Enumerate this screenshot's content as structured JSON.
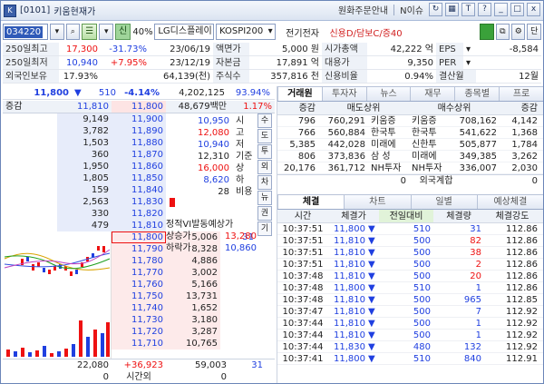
{
  "window": {
    "code_tag": "[0101]",
    "title": "키움현재가",
    "links": [
      "원화주문안내",
      "N이슈"
    ],
    "buttons": [
      "T",
      "?",
      "_",
      "□",
      "x"
    ]
  },
  "toolbar": {
    "code": "034220",
    "percent": "40%",
    "sin_label": "신",
    "name": "LG디스플레이",
    "market": "KOSPI200",
    "sector": "전기전자",
    "credit": "신용D/담보C/증40",
    "end_button": "단"
  },
  "info": {
    "high250_label": "250일최고",
    "high250_value": "17,300",
    "high250_pct": "-31.73%",
    "high250_date": "23/06/19",
    "low250_label": "250일최저",
    "low250_value": "10,940",
    "low250_pct": "+7.95%",
    "low250_date": "23/12/19",
    "foreign_label": "외국인보유",
    "foreign_value": "17.93%",
    "par_label": "액면가",
    "par_value": "5,000 원",
    "capital_label": "자본금",
    "capital_value": "17,891 억",
    "shares_label": "주식수",
    "shares_value": "357,816 천",
    "shares_sub": "64,139(천)",
    "mcap_label": "시가총액",
    "mcap_value": "42,222 억",
    "substitute_label": "대용가",
    "substitute_value": "9,350",
    "credit_label": "신용비율",
    "credit_value": "0.94%",
    "eps_label": "EPS",
    "eps_value": "-8,584",
    "per_label": "PER",
    "per_value": "",
    "settle_label": "결산월",
    "settle_value": "12월"
  },
  "price_bar": {
    "price": "11,800",
    "arrow": "▼",
    "change": "510",
    "change_pct": "-4.14%",
    "volume": "4,202,125",
    "vol_pct": "93.94%"
  },
  "ob_head": {
    "col1": "증감",
    "col2": "11,810",
    "col3": "11,800",
    "col4": "48,679백만",
    "col5": "1.17%"
  },
  "asks": [
    {
      "qty": "9,149",
      "price": "11,900"
    },
    {
      "qty": "3,782",
      "price": "11,890"
    },
    {
      "qty": "1,503",
      "price": "11,880"
    },
    {
      "qty": "360",
      "price": "11,870"
    },
    {
      "qty": "1,950",
      "price": "11,860"
    },
    {
      "qty": "1,805",
      "price": "11,850"
    },
    {
      "qty": "159",
      "price": "11,840"
    },
    {
      "qty": "2,563",
      "price": "11,830"
    },
    {
      "qty": "330",
      "price": "11,820"
    },
    {
      "qty": "479",
      "price": "11,810"
    }
  ],
  "bids": [
    {
      "price": "11,800",
      "qty": "5,006",
      "chg": "31"
    },
    {
      "price": "11,790",
      "qty": "8,328",
      "chg": ""
    },
    {
      "price": "11,780",
      "qty": "4,886",
      "chg": ""
    },
    {
      "price": "11,770",
      "qty": "3,002",
      "chg": ""
    },
    {
      "price": "11,760",
      "qty": "5,166",
      "chg": ""
    },
    {
      "price": "11,750",
      "qty": "13,731",
      "chg": ""
    },
    {
      "price": "11,740",
      "qty": "1,652",
      "chg": ""
    },
    {
      "price": "11,730",
      "qty": "3,180",
      "chg": ""
    },
    {
      "price": "11,720",
      "qty": "3,287",
      "chg": ""
    },
    {
      "price": "11,710",
      "qty": "10,765",
      "chg": ""
    }
  ],
  "ohlc": [
    {
      "value": "10,950",
      "label": "시"
    },
    {
      "value": "12,080",
      "label": "고"
    },
    {
      "value": "10,940",
      "label": "저"
    },
    {
      "value": "12,310",
      "label": "기준"
    },
    {
      "value": "16,000",
      "label": "상"
    },
    {
      "value": "8,620",
      "label": "하"
    },
    {
      "value": "28",
      "label": "비용"
    }
  ],
  "vi": {
    "title": "정적VI발동예상가",
    "up_label": "상승가",
    "up_value": "13,280",
    "down_label": "하락가",
    "down_value": "10,860"
  },
  "side_tabs": [
    "수",
    "도",
    "투",
    "외",
    "차",
    "뉴",
    "권",
    "기"
  ],
  "summary": {
    "ask_total": "22,080",
    "diff": "+36,923",
    "bid_total": "59,003",
    "chg": "31",
    "after_label": "시간외",
    "after_value": "0"
  },
  "right_tabs": [
    "거래원",
    "투자자",
    "뉴스",
    "재무",
    "종목별",
    "프로"
  ],
  "broker_head": {
    "chg1": "증감",
    "sell": "매도상위",
    "buy": "매수상위",
    "chg2": "증감"
  },
  "brokers": [
    {
      "chg1": "796",
      "sell_qty": "760,291",
      "sell_name": "키움증",
      "buy_name": "키움증",
      "buy_qty": "708,162",
      "chg2": "4,142"
    },
    {
      "chg1": "766",
      "sell_qty": "560,884",
      "sell_name": "한국투",
      "buy_name": "한국투",
      "buy_qty": "541,622",
      "chg2": "1,368"
    },
    {
      "chg1": "5,385",
      "sell_qty": "442,028",
      "sell_name": "미래에",
      "buy_name": "신한투",
      "buy_qty": "505,877",
      "chg2": "1,784"
    },
    {
      "chg1": "806",
      "sell_qty": "373,836",
      "sell_name": "삼 성",
      "buy_name": "미래에",
      "buy_qty": "349,385",
      "chg2": "3,262"
    },
    {
      "chg1": "20,176",
      "sell_qty": "361,712",
      "sell_name": "NH투자",
      "buy_name": "NH투자",
      "buy_qty": "336,007",
      "chg2": "2,030"
    }
  ],
  "foreign_row": {
    "left": "0",
    "label": "외국계합",
    "right": "0"
  },
  "trade_tabs": [
    "체결",
    "차트",
    "일별",
    "예상체결"
  ],
  "trade_head": {
    "time": "시간",
    "price": "체결가",
    "change": "전일대비",
    "qty": "체결량",
    "strength": "체결강도"
  },
  "trades": [
    {
      "time": "10:37:51",
      "price": "11,800",
      "dir": "▼",
      "change": "510",
      "qty": "31",
      "side": "buy",
      "strength": "112.86"
    },
    {
      "time": "10:37:51",
      "price": "11,810",
      "dir": "▼",
      "change": "500",
      "qty": "82",
      "side": "sell",
      "strength": "112.86"
    },
    {
      "time": "10:37:51",
      "price": "11,810",
      "dir": "▼",
      "change": "500",
      "qty": "38",
      "side": "sell",
      "strength": "112.86"
    },
    {
      "time": "10:37:51",
      "price": "11,810",
      "dir": "▼",
      "change": "500",
      "qty": "2",
      "side": "sell",
      "strength": "112.86"
    },
    {
      "time": "10:37:48",
      "price": "11,810",
      "dir": "▼",
      "change": "500",
      "qty": "20",
      "side": "sell",
      "strength": "112.86"
    },
    {
      "time": "10:37:48",
      "price": "11,800",
      "dir": "▼",
      "change": "510",
      "qty": "1",
      "side": "buy",
      "strength": "112.86"
    },
    {
      "time": "10:37:48",
      "price": "11,810",
      "dir": "▼",
      "change": "500",
      "qty": "965",
      "side": "buy",
      "strength": "112.85"
    },
    {
      "time": "10:37:47",
      "price": "11,810",
      "dir": "▼",
      "change": "500",
      "qty": "7",
      "side": "buy",
      "strength": "112.92"
    },
    {
      "time": "10:37:44",
      "price": "11,810",
      "dir": "▼",
      "change": "500",
      "qty": "1",
      "side": "buy",
      "strength": "112.92"
    },
    {
      "time": "10:37:44",
      "price": "11,810",
      "dir": "▼",
      "change": "500",
      "qty": "1",
      "side": "buy",
      "strength": "112.92"
    },
    {
      "time": "10:37:44",
      "price": "11,830",
      "dir": "▼",
      "change": "480",
      "qty": "132",
      "side": "buy",
      "strength": "112.92"
    },
    {
      "time": "10:37:41",
      "price": "11,800",
      "dir": "▼",
      "change": "510",
      "qty": "840",
      "side": "buy",
      "strength": "112.91"
    }
  ],
  "colors": {
    "up": "#e11111",
    "down": "#1f3fe0",
    "ask_bg": "#e7ecfa",
    "bid_bg": "#fdeaea"
  }
}
